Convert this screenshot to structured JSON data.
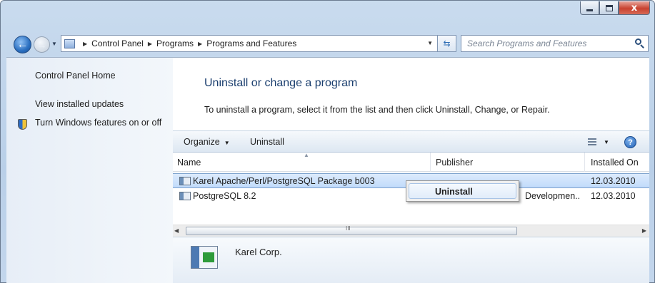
{
  "window": {
    "minimize_label": "",
    "close_label": "x"
  },
  "nav": {
    "breadcrumbs": [
      "Control Panel",
      "Programs",
      "Programs and Features"
    ],
    "search_placeholder": "Search Programs and Features"
  },
  "sidebar": {
    "items": [
      {
        "label": "Control Panel Home"
      },
      {
        "label": "View installed updates"
      },
      {
        "label": "Turn Windows features on or off"
      }
    ]
  },
  "main": {
    "heading": "Uninstall or change a program",
    "subheading": "To uninstall a program, select it from the list and then click Uninstall, Change, or Repair.",
    "toolbar": {
      "organize_label": "Organize",
      "uninstall_label": "Uninstall",
      "help_label": "?"
    },
    "columns": {
      "name": "Name",
      "publisher": "Publisher",
      "installed_on": "Installed On"
    },
    "rows": [
      {
        "name": "Karel Apache/Perl/PostgreSQL Package b003",
        "publisher": "",
        "installed_on": "12.03.2010",
        "selected": true
      },
      {
        "name": "PostgreSQL 8.2",
        "publisher": "Developmen...",
        "installed_on": "12.03.2010",
        "selected": false
      }
    ],
    "context_menu": {
      "items": [
        "Uninstall"
      ]
    },
    "scrollbar_grip": "III",
    "details": {
      "publisher": "Karel Corp."
    }
  }
}
